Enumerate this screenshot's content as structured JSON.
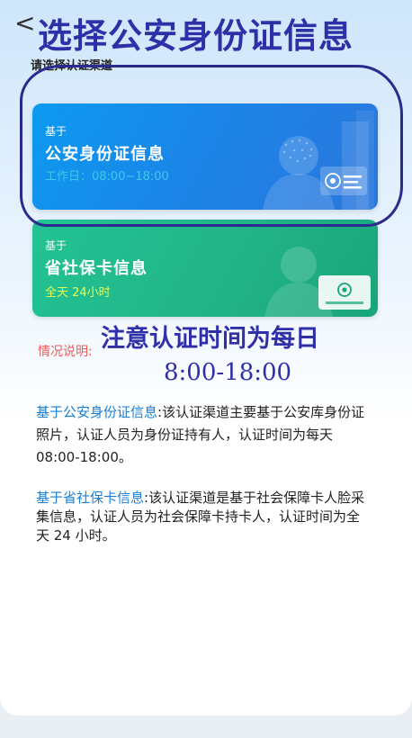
{
  "header": {
    "back_icon": "chevron-left-icon",
    "back_glyph": "<",
    "title": "选择公安身份证信息",
    "subtitle": "请选择认证渠道"
  },
  "cards": [
    {
      "prefix": "基于",
      "name": "公安身份证信息",
      "time": "工作日：08:00~18:00",
      "color": "#1a86e8",
      "time_color": "#3fc8ee"
    },
    {
      "prefix": "基于",
      "name": "省社保卡信息",
      "time": "全天 24小时",
      "color": "#21b487",
      "time_color": "#e6f95a"
    }
  ],
  "notes": {
    "label": "情况说明:",
    "handwritten_line1": "注意认证时间为每日",
    "handwritten_line2": "8:00-18:00",
    "annotation_color": "#2f2fa8"
  },
  "descriptions": [
    {
      "highlight": "基于公安身份证信息",
      "text": ":该认证渠道主要基于公安库身份证照片，认证人员为身份证持有人，认证时间为每天 08:00-18:00。"
    },
    {
      "highlight": "基于省社保卡信息",
      "text": ":该认证渠道是基于社会保障卡人脸采集信息，认证人员为社会保障卡持卡人，认证时间为全天 24 小时。"
    }
  ],
  "colors": {
    "link_blue": "#1b7fd1",
    "warning_red": "#ee5a5a"
  }
}
